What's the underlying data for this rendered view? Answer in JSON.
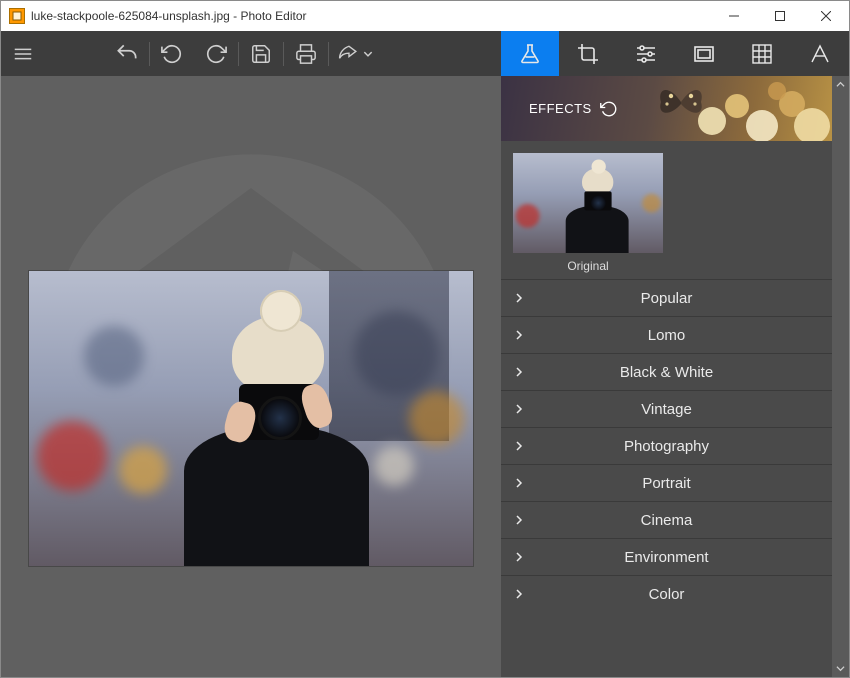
{
  "window": {
    "title": "luke-stackpoole-625084-unsplash.jpg - Photo Editor"
  },
  "toolbar": {
    "icons": {
      "menu": "menu-icon",
      "undo": "undo-icon",
      "redo_alt": "undo-step-icon",
      "redo": "redo-icon",
      "save": "save-icon",
      "print": "print-icon",
      "share": "share-icon"
    }
  },
  "side_tabs": [
    {
      "name": "effects",
      "icon": "flask-icon",
      "active": true
    },
    {
      "name": "crop",
      "icon": "crop-icon",
      "active": false
    },
    {
      "name": "adjust",
      "icon": "sliders-icon",
      "active": false
    },
    {
      "name": "frames",
      "icon": "frame-icon",
      "active": false
    },
    {
      "name": "textures",
      "icon": "texture-icon",
      "active": false
    },
    {
      "name": "text",
      "icon": "type-icon",
      "active": false
    }
  ],
  "effects": {
    "header_label": "EFFECTS",
    "thumbnail_caption": "Original",
    "categories": [
      "Popular",
      "Lomo",
      "Black & White",
      "Vintage",
      "Photography",
      "Portrait",
      "Cinema",
      "Environment",
      "Color"
    ]
  }
}
